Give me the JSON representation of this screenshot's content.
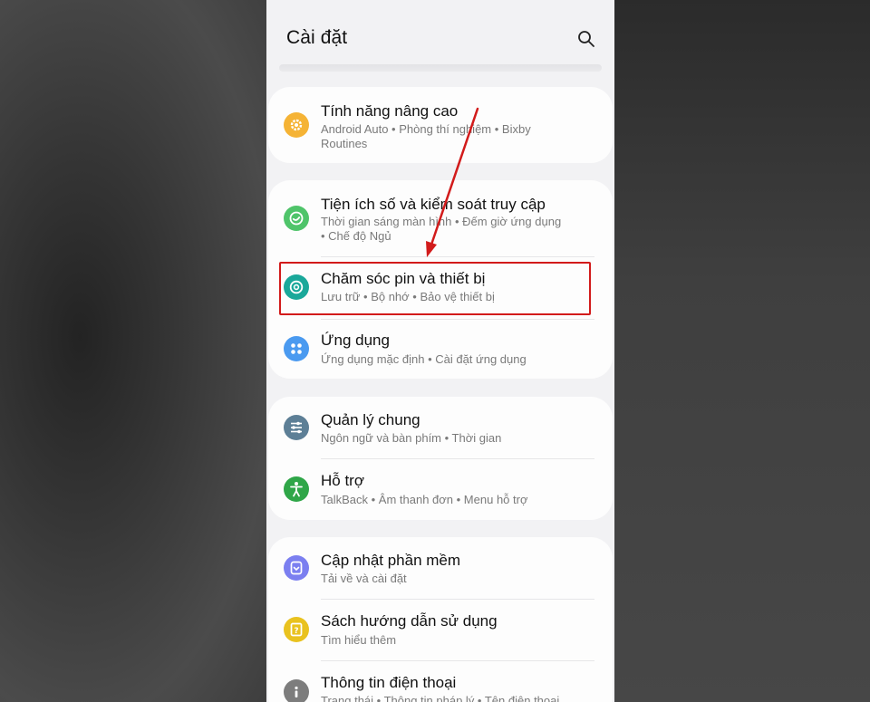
{
  "header": {
    "title": "Cài đặt"
  },
  "cards": [
    {
      "items": [
        {
          "title": "Tính năng nâng cao",
          "subtitle": "Android Auto  •  Phòng thí nghiệm  •  Bixby Routines",
          "icon": "gear-icon",
          "icon_color": "#f5b335"
        }
      ]
    },
    {
      "items": [
        {
          "title": "Tiện ích số và kiểm soát truy cập",
          "subtitle": "Thời gian sáng màn hình  •  Đếm giờ ứng dụng  •  Chế độ Ngủ",
          "icon": "digital-wellbeing-icon",
          "icon_color": "#4fc46a"
        },
        {
          "title": "Chăm sóc pin và thiết bị",
          "subtitle": "Lưu trữ  •  Bộ nhớ  •  Bảo vệ thiết bị",
          "icon": "device-care-icon",
          "icon_color": "#1aa89a"
        },
        {
          "title": "Ứng dụng",
          "subtitle": "Ứng dụng mặc định  •  Cài đặt ứng dụng",
          "icon": "apps-icon",
          "icon_color": "#4a9af0"
        }
      ]
    },
    {
      "items": [
        {
          "title": "Quản lý chung",
          "subtitle": "Ngôn ngữ và bàn phím  •  Thời gian",
          "icon": "sliders-icon",
          "icon_color": "#5d7f96"
        },
        {
          "title": "Hỗ trợ",
          "subtitle": "TalkBack  •  Âm thanh đơn  •  Menu hỗ trợ",
          "icon": "accessibility-icon",
          "icon_color": "#2fa648"
        }
      ]
    },
    {
      "items": [
        {
          "title": "Cập nhật phần mềm",
          "subtitle": "Tải về và cài đặt",
          "icon": "software-update-icon",
          "icon_color": "#7b7ff0"
        },
        {
          "title": "Sách hướng dẫn sử dụng",
          "subtitle": "Tìm hiểu thêm",
          "icon": "user-manual-icon",
          "icon_color": "#e9c21f"
        },
        {
          "title": "Thông tin điện thoại",
          "subtitle": "Trạng thái  •  Thông tin pháp lý  •  Tên điện thoại",
          "icon": "info-icon",
          "icon_color": "#7d7d7d"
        }
      ]
    }
  ],
  "annotation": {
    "highlight_color": "#d21b1b"
  }
}
